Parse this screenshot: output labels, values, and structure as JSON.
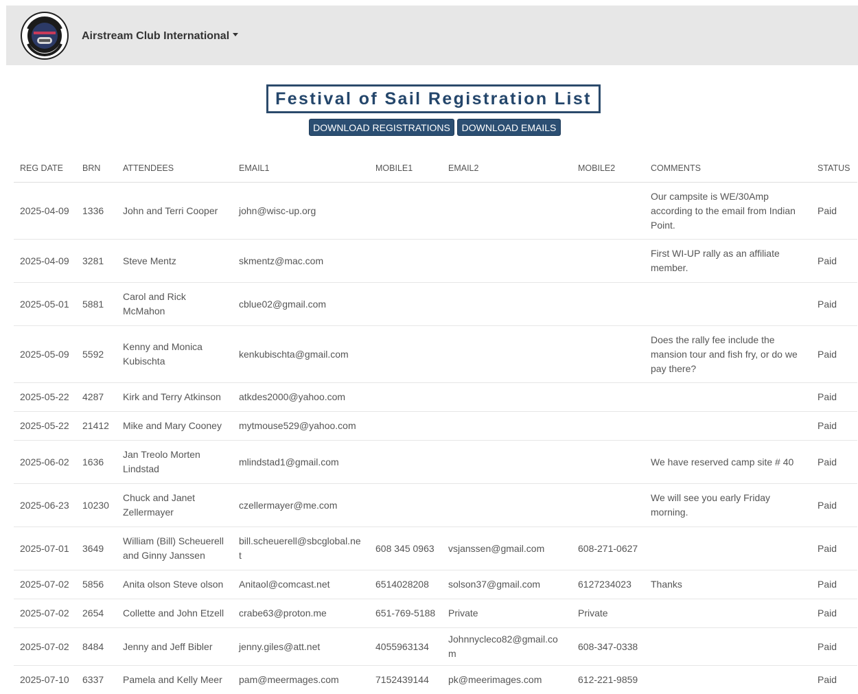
{
  "navbar": {
    "brand_label": "Airstream Club International",
    "logo_top_text": "WISC-UP",
    "logo_bottom_text": "AIRSTREAM CLUB"
  },
  "page": {
    "title": "Festival of Sail Registration List"
  },
  "actions": {
    "download_registrations": "DOWNLOAD REGISTRATIONS",
    "download_emails": "DOWNLOAD EMAILS"
  },
  "table": {
    "headers": [
      "REG DATE",
      "BRN",
      "ATTENDEES",
      "EMAIL1",
      "MOBILE1",
      "EMAIL2",
      "MOBILE2",
      "COMMENTS",
      "STATUS"
    ],
    "rows": [
      [
        "2025-04-09",
        "1336",
        "John and Terri Cooper",
        "john@wisc-up.org",
        "",
        "",
        "",
        "Our campsite is WE/30Amp according to the email from Indian Point.",
        "Paid"
      ],
      [
        "2025-04-09",
        "3281",
        "Steve Mentz",
        "skmentz@mac.com",
        "",
        "",
        "",
        "First WI-UP rally as an affiliate member.",
        "Paid"
      ],
      [
        "2025-05-01",
        "5881",
        "Carol and Rick McMahon",
        "cblue02@gmail.com",
        "",
        "",
        "",
        "",
        "Paid"
      ],
      [
        "2025-05-09",
        "5592",
        "Kenny and Monica Kubischta",
        "kenkubischta@gmail.com",
        "",
        "",
        "",
        "Does the rally fee include the mansion tour and fish fry, or do we pay there?",
        "Paid"
      ],
      [
        "2025-05-22",
        "4287",
        "Kirk and Terry Atkinson",
        "atkdes2000@yahoo.com",
        "",
        "",
        "",
        "",
        "Paid"
      ],
      [
        "2025-05-22",
        "21412",
        "Mike and Mary Cooney",
        "mytmouse529@yahoo.com",
        "",
        "",
        "",
        "",
        "Paid"
      ],
      [
        "2025-06-02",
        "1636",
        "Jan Treolo Morten Lindstad",
        "mlindstad1@gmail.com",
        "",
        "",
        "",
        "We have reserved camp site # 40",
        "Paid"
      ],
      [
        "2025-06-23",
        "10230",
        "Chuck and Janet Zellermayer",
        "czellermayer@me.com",
        "",
        "",
        "",
        "We will see you early Friday morning.",
        "Paid"
      ],
      [
        "2025-07-01",
        "3649",
        "William (Bill) Scheuerell and Ginny Janssen",
        "bill.scheuerell@sbcglobal.net",
        "608 345 0963",
        "vsjanssen@gmail.com",
        "608-271-0627",
        "",
        "Paid"
      ],
      [
        "2025-07-02",
        "5856",
        "Anita olson Steve olson",
        "Anitaol@comcast.net",
        "6514028208",
        "solson37@gmail.com",
        "6127234023",
        "Thanks",
        "Paid"
      ],
      [
        "2025-07-02",
        "2654",
        "Collette and John Etzell",
        "crabe63@proton.me",
        "651-769-5188",
        "Private",
        "Private",
        "",
        "Paid"
      ],
      [
        "2025-07-02",
        "8484",
        "Jenny and Jeff Bibler",
        "jenny.giles@att.net",
        "4055963134",
        "Johnnycleco82@gmail.com",
        "608-347-0338",
        "",
        "Paid"
      ],
      [
        "2025-07-10",
        "6337",
        "Pamela and Kelly Meer",
        "pam@meermages.com",
        "7152439144",
        "pk@meerimages.com",
        "612-221-9859",
        "",
        "Paid"
      ]
    ]
  }
}
